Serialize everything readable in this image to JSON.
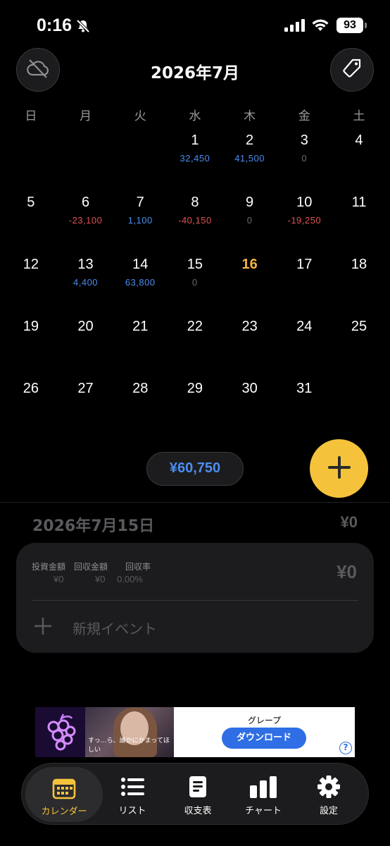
{
  "status_bar": {
    "time": "0:16",
    "battery": "93"
  },
  "header": {
    "month_title": "2026年7月"
  },
  "weekdays": [
    "日",
    "月",
    "火",
    "水",
    "木",
    "金",
    "土"
  ],
  "calendar": [
    {
      "day": "",
      "amount": "",
      "kind": ""
    },
    {
      "day": "",
      "amount": "",
      "kind": ""
    },
    {
      "day": "",
      "amount": "",
      "kind": ""
    },
    {
      "day": "1",
      "amount": "32,450",
      "kind": "pos"
    },
    {
      "day": "2",
      "amount": "41,500",
      "kind": "pos"
    },
    {
      "day": "3",
      "amount": "0",
      "kind": "zero"
    },
    {
      "day": "4",
      "amount": "",
      "kind": ""
    },
    {
      "day": "5",
      "amount": "",
      "kind": ""
    },
    {
      "day": "6",
      "amount": "-23,100",
      "kind": "neg"
    },
    {
      "day": "7",
      "amount": "1,100",
      "kind": "pos"
    },
    {
      "day": "8",
      "amount": "-40,150",
      "kind": "neg"
    },
    {
      "day": "9",
      "amount": "0",
      "kind": "zero"
    },
    {
      "day": "10",
      "amount": "-19,250",
      "kind": "neg"
    },
    {
      "day": "11",
      "amount": "",
      "kind": ""
    },
    {
      "day": "12",
      "amount": "",
      "kind": ""
    },
    {
      "day": "13",
      "amount": "4,400",
      "kind": "pos"
    },
    {
      "day": "14",
      "amount": "63,800",
      "kind": "pos"
    },
    {
      "day": "15",
      "amount": "0",
      "kind": "zero",
      "selected": true
    },
    {
      "day": "16",
      "amount": "",
      "kind": "",
      "today": true
    },
    {
      "day": "17",
      "amount": "",
      "kind": ""
    },
    {
      "day": "18",
      "amount": "",
      "kind": ""
    },
    {
      "day": "19",
      "amount": "",
      "kind": ""
    },
    {
      "day": "20",
      "amount": "",
      "kind": ""
    },
    {
      "day": "21",
      "amount": "",
      "kind": ""
    },
    {
      "day": "22",
      "amount": "",
      "kind": ""
    },
    {
      "day": "23",
      "amount": "",
      "kind": ""
    },
    {
      "day": "24",
      "amount": "",
      "kind": ""
    },
    {
      "day": "25",
      "amount": "",
      "kind": ""
    },
    {
      "day": "26",
      "amount": "",
      "kind": ""
    },
    {
      "day": "27",
      "amount": "",
      "kind": ""
    },
    {
      "day": "28",
      "amount": "",
      "kind": ""
    },
    {
      "day": "29",
      "amount": "",
      "kind": ""
    },
    {
      "day": "30",
      "amount": "",
      "kind": ""
    },
    {
      "day": "31",
      "amount": "",
      "kind": ""
    }
  ],
  "summary": {
    "month_total": "¥60,750"
  },
  "day_detail": {
    "date_title": "2026年7月15日",
    "day_total": "¥0",
    "card": {
      "invest_label": "投資金額",
      "invest_value": "¥0",
      "recover_label": "回収金額",
      "recover_value": "¥0",
      "rate_label": "回収率",
      "rate_value": "0.00%",
      "total": "¥0",
      "new_event_label": "新規イベント"
    }
  },
  "ad": {
    "caption": "すっ…ら、誰かにかまってほしい",
    "app_name": "グレープ",
    "download_label": "ダウンロード",
    "info_label": "?"
  },
  "tabs": [
    {
      "label": "カレンダー",
      "icon": "calendar-icon",
      "active": true
    },
    {
      "label": "リスト",
      "icon": "list-icon"
    },
    {
      "label": "収支表",
      "icon": "document-icon"
    },
    {
      "label": "チャート",
      "icon": "bar-chart-icon"
    },
    {
      "label": "設定",
      "icon": "gear-icon"
    }
  ],
  "colors": {
    "accent": "#f5c33b",
    "positive": "#4a8ef0",
    "negative": "#e05252",
    "zero": "#6c6c70",
    "background": "#000000"
  }
}
